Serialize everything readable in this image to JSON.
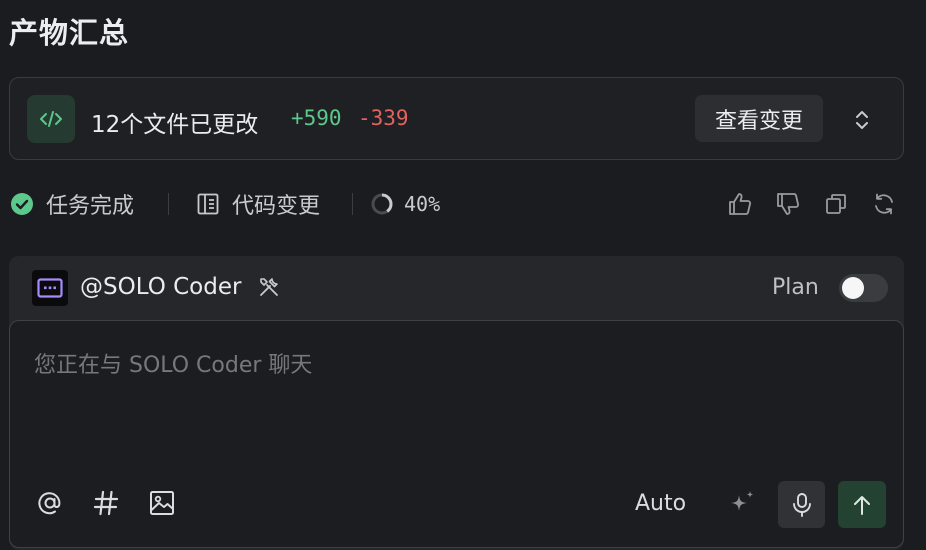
{
  "page_title": "产物汇总",
  "changes": {
    "icon": "code-icon",
    "summary": "12个文件已更改",
    "additions": "+590",
    "deletions": "-339",
    "view_button": "查看变更",
    "expand_icon": "chevron-up-down-icon",
    "colors": {
      "additions": "#5cc88b",
      "deletions": "#e5625f",
      "badge_bg": "#253a30"
    }
  },
  "status": {
    "task_complete": "任务完成",
    "code_changes": "代码变更",
    "progress": "40%",
    "progress_value": 0.4,
    "actions": [
      "thumbs-up-icon",
      "thumbs-down-icon",
      "copy-icon",
      "refresh-icon"
    ]
  },
  "composer": {
    "agent_name": "@SOLO Coder",
    "agent_icon": "robot-icon",
    "tools_icon": "tools-icon",
    "plan_label": "Plan",
    "plan_enabled": false,
    "placeholder": "您正在与 SOLO Coder 聊天",
    "mode": "Auto",
    "bottom_icons": [
      "at-icon",
      "hash-icon",
      "image-icon"
    ],
    "sparkle_icon": "sparkle-icon",
    "mic_icon": "microphone-icon",
    "send_icon": "arrow-up-icon",
    "colors": {
      "send_bg": "#234232",
      "accent": "#5cc88b"
    }
  }
}
